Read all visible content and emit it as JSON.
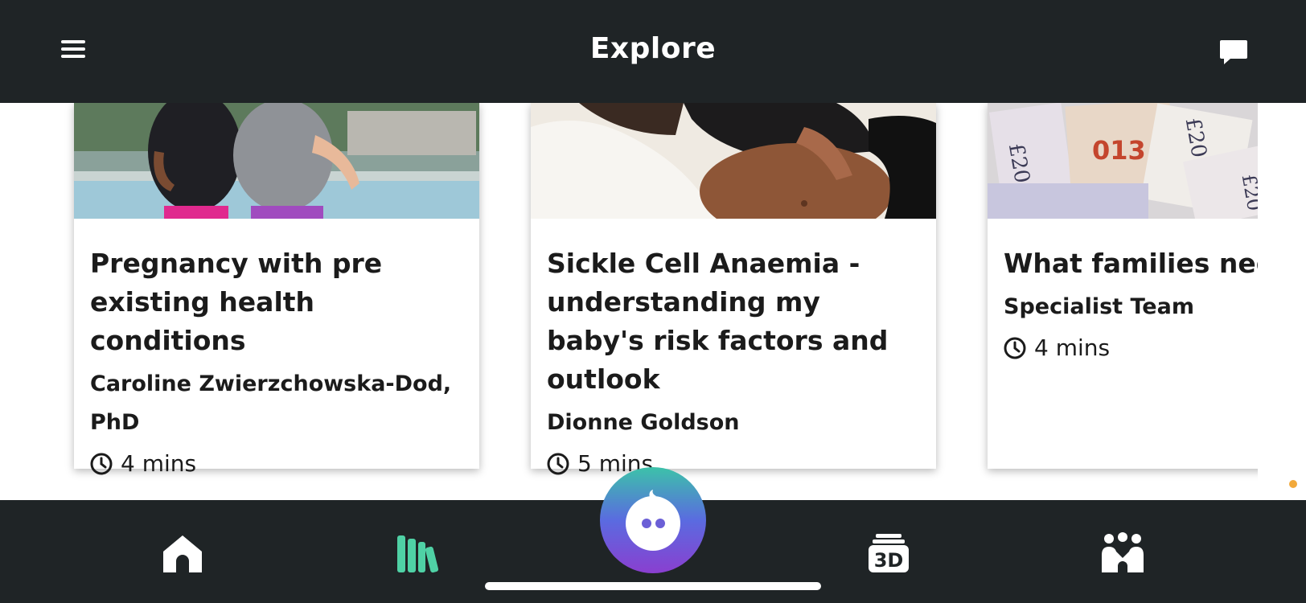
{
  "header": {
    "title": "Explore"
  },
  "cards": [
    {
      "title": "Pregnancy with pre existing health conditions",
      "author_line1": "Caroline Zwierzchowska-Dod,",
      "author_line2": "PhD",
      "duration": "4 mins"
    },
    {
      "title": "Sickle Cell Anaemia - understanding my baby's risk factors and outlook",
      "author": "Dionne Goldson",
      "duration": "5 mins"
    },
    {
      "title": "What families need",
      "author": "Specialist Team",
      "duration": "4 mins"
    }
  ],
  "bottom_nav": {
    "items": [
      "home-icon",
      "library-icon",
      "assistant-icon",
      "3d-icon",
      "community-icon"
    ],
    "label_3d": "3D"
  },
  "colors": {
    "bar_background": "#1f2426",
    "library_accent": "#4fd1a5",
    "scroll_indicator": "#f2a93b"
  }
}
